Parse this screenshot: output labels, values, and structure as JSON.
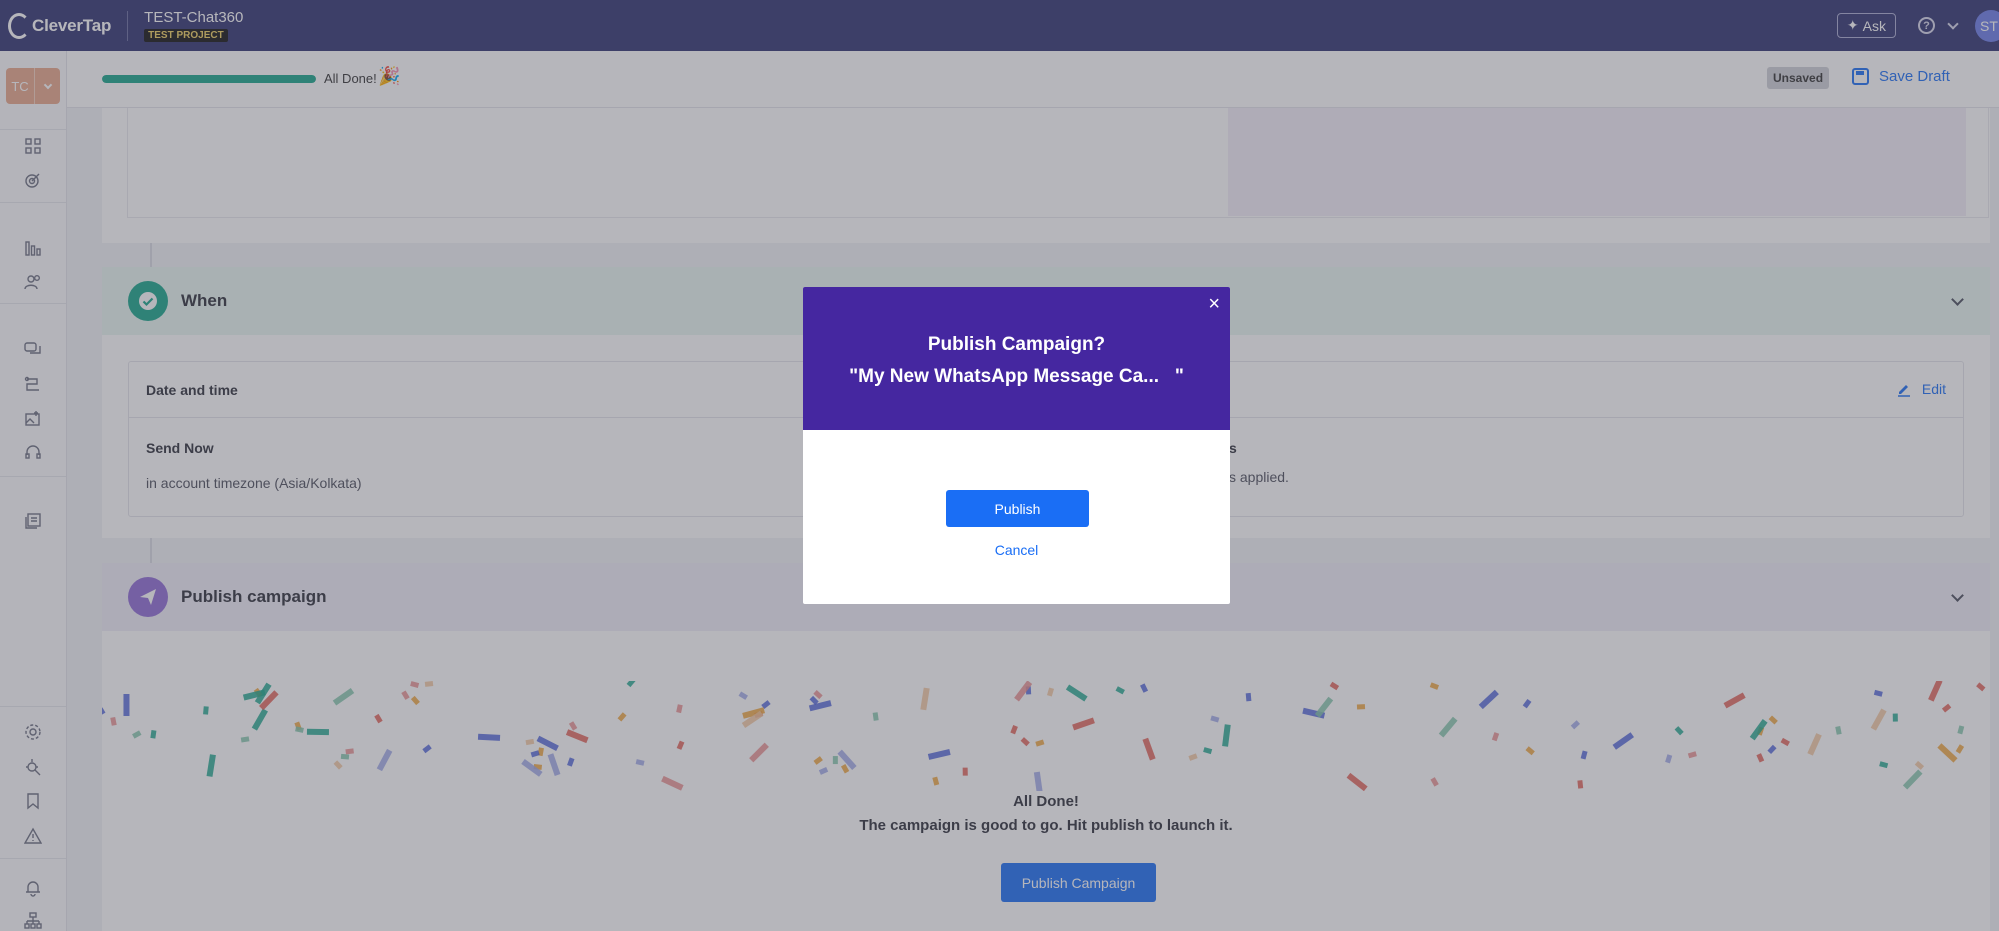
{
  "app": {
    "logo_text": "CleverTap",
    "project_name": "TEST-Chat360",
    "project_badge": "TEST PROJECT",
    "ask_label": "Ask",
    "avatar_initials": "ST",
    "brand_color": "#2f3270"
  },
  "sidebar": {
    "workspace_initials": "TC",
    "icons": [
      "dashboard-icon",
      "target-icon",
      "analytics-icon",
      "users-icon",
      "messages-icon",
      "journeys-icon",
      "media-icon",
      "support-icon",
      "catalog-icon",
      "settings-icon",
      "debug-icon",
      "bookmark-icon",
      "alert-icon",
      "notifications-icon",
      "sitemap-icon"
    ]
  },
  "progress": {
    "value_percent": 100,
    "label": "All Done!",
    "color": "#17a58a"
  },
  "toolbar": {
    "status_badge": "Unsaved",
    "save_draft_label": "Save Draft"
  },
  "when_section": {
    "title": "When",
    "card_title": "Date and time",
    "edit_label": "Edit",
    "send_now_title": "Send Now",
    "send_now_sub": "in account timezone (Asia/Kolkata)",
    "right_col_title": "s",
    "right_col_sub": "s applied."
  },
  "publish_section": {
    "title": "Publish campaign",
    "all_done": "All Done!",
    "message": "The campaign is good to go. Hit publish to launch it.",
    "button_label": "Publish Campaign"
  },
  "modal": {
    "title": "Publish Campaign?",
    "subtitle": "\"My New WhatsApp Message Ca...   \"",
    "close_glyph": "×",
    "publish_label": "Publish",
    "cancel_label": "Cancel",
    "header_color": "#4527a0"
  }
}
